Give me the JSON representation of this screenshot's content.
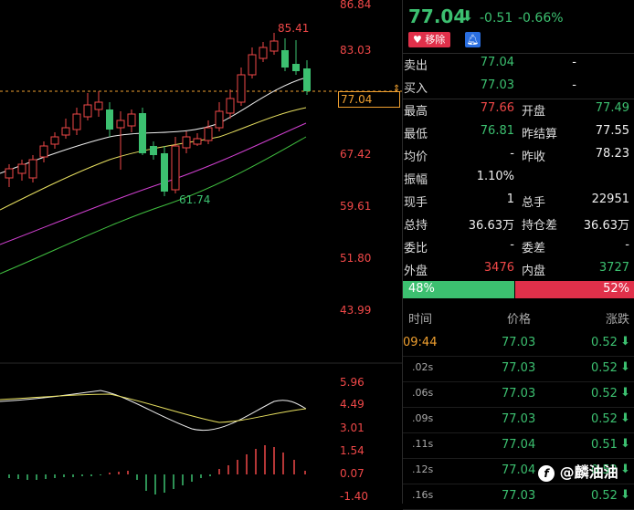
{
  "chart": {
    "y_labels": [
      "83.03",
      "77.04",
      "67.42",
      "59.61",
      "51.80",
      "43.99",
      "5.96",
      "4.49",
      "3.01",
      "1.54",
      "0.07",
      "-1.40"
    ],
    "high_annotation": "85.41",
    "low_annotation": "61.74",
    "current_price_tag": "77.04"
  },
  "quote": {
    "price": "77.04",
    "change": "-0.51",
    "change_pct": "-0.66%",
    "remove_button": "移除",
    "bell_icon": "bell-icon"
  },
  "orderbook": [
    {
      "label": "卖出",
      "price": "77.04",
      "volume": "-"
    },
    {
      "label": "买入",
      "price": "77.03",
      "volume": "-"
    }
  ],
  "stats": [
    {
      "l1": "最高",
      "v1": "77.66",
      "c1": "red",
      "l2": "开盘",
      "v2": "77.49",
      "c2": "green"
    },
    {
      "l1": "最低",
      "v1": "76.81",
      "c1": "green",
      "l2": "昨结算",
      "v2": "77.55",
      "c2": "white"
    },
    {
      "l1": "均价",
      "v1": "-",
      "c1": "white",
      "l2": "昨收",
      "v2": "78.23",
      "c2": "white"
    },
    {
      "l1": "振幅",
      "v1": "1.10%",
      "c1": "white",
      "l2": "",
      "v2": "",
      "c2": "white"
    },
    {
      "l1": "现手",
      "v1": "1",
      "c1": "white",
      "l2": "总手",
      "v2": "22951",
      "c2": "white"
    },
    {
      "l1": "总持",
      "v1": "36.63万",
      "c1": "white",
      "l2": "持仓差",
      "v2": "36.63万",
      "c2": "white"
    },
    {
      "l1": "委比",
      "v1": "-",
      "c1": "white",
      "l2": "委差",
      "v2": "-",
      "c2": "white"
    },
    {
      "l1": "外盘",
      "v1": "3476",
      "c1": "red",
      "l2": "内盘",
      "v2": "3727",
      "c2": "green"
    }
  ],
  "ratio": {
    "left": "48%",
    "right": "52%",
    "left_fraction": 0.48
  },
  "ticks_header": {
    "time": "时间",
    "price": "价格",
    "change": "涨跌"
  },
  "ticks": [
    {
      "time": "09:44",
      "price": "77.03",
      "change": "0.52"
    },
    {
      "time": ".02s",
      "price": "77.03",
      "change": "0.52"
    },
    {
      "time": ".06s",
      "price": "77.03",
      "change": "0.52"
    },
    {
      "time": ".09s",
      "price": "77.03",
      "change": "0.52"
    },
    {
      "time": ".11s",
      "price": "77.04",
      "change": "0.51"
    },
    {
      "time": ".12s",
      "price": "77.04",
      "change": "0.52"
    },
    {
      "time": ".16s",
      "price": "77.03",
      "change": "0.52"
    }
  ],
  "watermark": "@麟油油",
  "colors": {
    "up": "#f04848",
    "down": "#3cc070",
    "accent": "#f0a030"
  }
}
